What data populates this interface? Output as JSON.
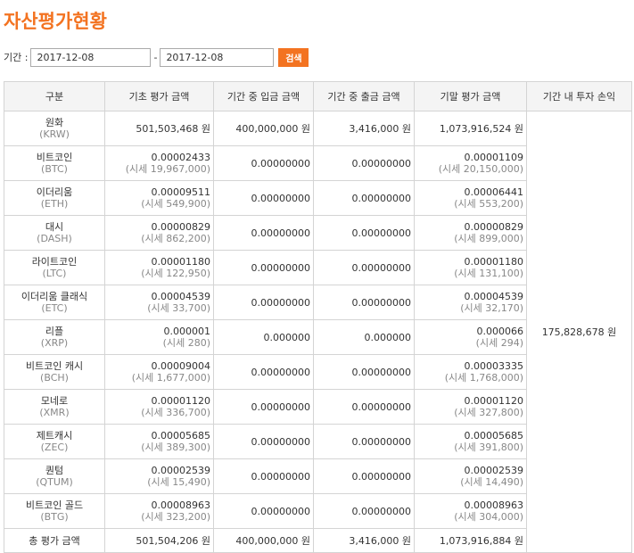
{
  "page": {
    "title": "자산평가현황"
  },
  "filter": {
    "label": "기간 :",
    "from": "2017-12-08",
    "separator": "-",
    "to": "2017-12-08",
    "search_label": "검색"
  },
  "table": {
    "headers": [
      "구분",
      "기초 평가 금액",
      "기간 중 입금 금액",
      "기간 중 출금 금액",
      "기말 평가 금액",
      "기간 내 투자 손익"
    ],
    "profit": "175,828,678 원",
    "rows": [
      {
        "name": "원화",
        "code": "(KRW)",
        "begin": "501,503,468 원",
        "begin_sub": "",
        "deposit": "400,000,000 원",
        "withdraw": "3,416,000 원",
        "end": "1,073,916,524 원",
        "end_sub": ""
      },
      {
        "name": "비트코인",
        "code": "(BTC)",
        "begin": "0.00002433",
        "begin_sub": "(시세 19,967,000)",
        "deposit": "0.00000000",
        "withdraw": "0.00000000",
        "end": "0.00001109",
        "end_sub": "(시세 20,150,000)"
      },
      {
        "name": "이더리움",
        "code": "(ETH)",
        "begin": "0.00009511",
        "begin_sub": "(시세 549,900)",
        "deposit": "0.00000000",
        "withdraw": "0.00000000",
        "end": "0.00006441",
        "end_sub": "(시세 553,200)"
      },
      {
        "name": "대시",
        "code": "(DASH)",
        "begin": "0.00000829",
        "begin_sub": "(시세 862,200)",
        "deposit": "0.00000000",
        "withdraw": "0.00000000",
        "end": "0.00000829",
        "end_sub": "(시세 899,000)"
      },
      {
        "name": "라이트코인",
        "code": "(LTC)",
        "begin": "0.00001180",
        "begin_sub": "(시세 122,950)",
        "deposit": "0.00000000",
        "withdraw": "0.00000000",
        "end": "0.00001180",
        "end_sub": "(시세 131,100)"
      },
      {
        "name": "이더리움 클래식",
        "code": "(ETC)",
        "begin": "0.00004539",
        "begin_sub": "(시세 33,700)",
        "deposit": "0.00000000",
        "withdraw": "0.00000000",
        "end": "0.00004539",
        "end_sub": "(시세 32,170)"
      },
      {
        "name": "리플",
        "code": "(XRP)",
        "begin": "0.000001",
        "begin_sub": "(시세 280)",
        "deposit": "0.000000",
        "withdraw": "0.000000",
        "end": "0.000066",
        "end_sub": "(시세 294)"
      },
      {
        "name": "비트코인 캐시",
        "code": "(BCH)",
        "begin": "0.00009004",
        "begin_sub": "(시세 1,677,000)",
        "deposit": "0.00000000",
        "withdraw": "0.00000000",
        "end": "0.00003335",
        "end_sub": "(시세 1,768,000)"
      },
      {
        "name": "모네로",
        "code": "(XMR)",
        "begin": "0.00001120",
        "begin_sub": "(시세 336,700)",
        "deposit": "0.00000000",
        "withdraw": "0.00000000",
        "end": "0.00001120",
        "end_sub": "(시세 327,800)"
      },
      {
        "name": "제트캐시",
        "code": "(ZEC)",
        "begin": "0.00005685",
        "begin_sub": "(시세 389,300)",
        "deposit": "0.00000000",
        "withdraw": "0.00000000",
        "end": "0.00005685",
        "end_sub": "(시세 391,800)"
      },
      {
        "name": "퀀텀",
        "code": "(QTUM)",
        "begin": "0.00002539",
        "begin_sub": "(시세 15,490)",
        "deposit": "0.00000000",
        "withdraw": "0.00000000",
        "end": "0.00002539",
        "end_sub": "(시세 14,490)"
      },
      {
        "name": "비트코인 골드",
        "code": "(BTG)",
        "begin": "0.00008963",
        "begin_sub": "(시세 323,200)",
        "deposit": "0.00000000",
        "withdraw": "0.00000000",
        "end": "0.00008963",
        "end_sub": "(시세 304,000)"
      }
    ],
    "total": {
      "label": "총 평가 금액",
      "begin": "501,504,206 원",
      "deposit": "400,000,000 원",
      "withdraw": "3,416,000 원",
      "end": "1,073,916,884 원"
    }
  },
  "colors": {
    "accent": "#f37321",
    "header_bg": "#f4f4f4",
    "border": "#d4d4d4",
    "subtext": "#888888"
  }
}
